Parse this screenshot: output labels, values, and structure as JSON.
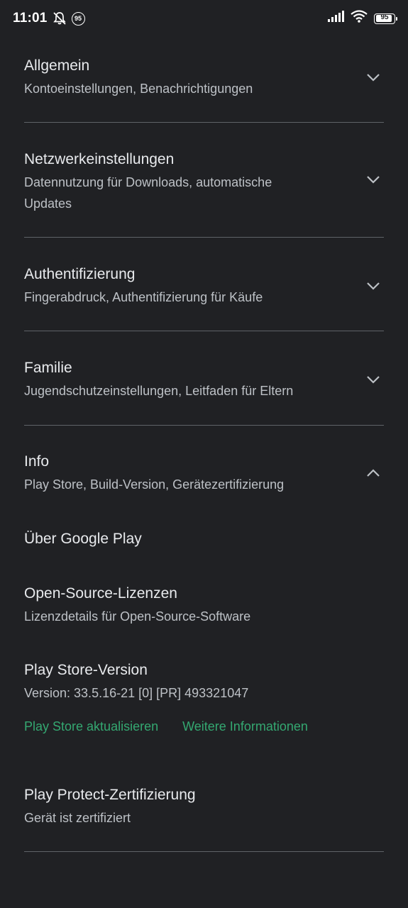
{
  "status_bar": {
    "time": "11:01",
    "notification_badge": "95",
    "battery_level": "95",
    "battery_fraction": 0.95
  },
  "sections": {
    "general": {
      "title": "Allgemein",
      "subtitle": "Kontoeinstellungen, Benachrichtigungen",
      "expanded": false
    },
    "network": {
      "title": "Netzwerkeinstellungen",
      "subtitle_line1": "Datennutzung für Downloads, automatische",
      "subtitle_line2": "Updates",
      "expanded": false
    },
    "authentication": {
      "title": "Authentifizierung",
      "subtitle": "Fingerabdruck, Authentifizierung für Käufe",
      "expanded": false
    },
    "family": {
      "title": "Familie",
      "subtitle": "Jugendschutzeinstellungen, Leitfaden für Eltern",
      "expanded": false
    },
    "info": {
      "title": "Info",
      "subtitle": "Play Store, Build-Version, Gerätezertifizierung",
      "expanded": true
    }
  },
  "info_items": {
    "about": {
      "title": "Über Google Play"
    },
    "licenses": {
      "title": "Open-Source-Lizenzen",
      "subtitle": "Lizenzdetails für Open-Source-Software"
    },
    "version": {
      "title": "Play Store-Version",
      "subtitle": "Version: 33.5.16-21 [0] [PR] 493321047",
      "update_link": "Play Store aktualisieren",
      "more_info_link": "Weitere Informationen"
    },
    "protect": {
      "title": "Play Protect-Zertifizierung",
      "subtitle": "Gerät ist zertifiziert"
    }
  },
  "colors": {
    "background": "#202124",
    "link": "#34a871",
    "divider": "#5f6368"
  },
  "icons": {
    "chevron_collapsed": "chevron-down-icon",
    "chevron_expanded": "chevron-up-icon",
    "mute": "bell-off-icon",
    "signal": "signal-icon",
    "wifi": "wifi-icon",
    "battery": "battery-icon"
  }
}
